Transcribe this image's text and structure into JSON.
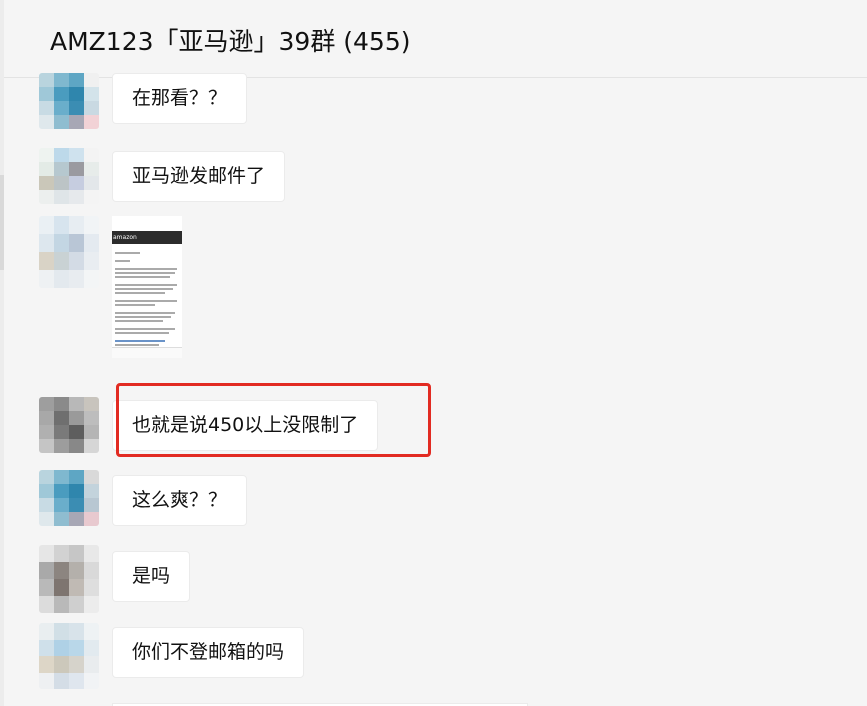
{
  "header": {
    "title": "AMZ123「亚马逊」39群 (455)"
  },
  "messages": [
    {
      "type": "text",
      "text": "在那看？？"
    },
    {
      "type": "text",
      "text": "亚马逊发邮件了"
    },
    {
      "type": "image",
      "brand_text": "amazon"
    },
    {
      "type": "text",
      "text": "也就是说450以上没限制了",
      "highlighted": true
    },
    {
      "type": "text",
      "text": "这么爽？？"
    },
    {
      "type": "text",
      "text": "是吗"
    },
    {
      "type": "text",
      "text": "你们不登邮箱的吗"
    }
  ],
  "colors": {
    "background": "#f5f5f5",
    "bubble": "#ffffff",
    "highlight": "#e22b22"
  }
}
